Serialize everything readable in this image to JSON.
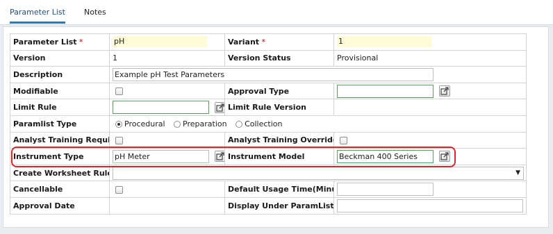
{
  "tabs": [
    {
      "label": "Parameter List",
      "active": true
    },
    {
      "label": "Notes",
      "active": false
    }
  ],
  "form": {
    "parameter_list": {
      "label": "Parameter List",
      "required_mark": "*",
      "value": "pH"
    },
    "variant": {
      "label": "Variant",
      "required_mark": "*",
      "value": "1"
    },
    "version": {
      "label": "Version",
      "value": "1"
    },
    "version_status": {
      "label": "Version Status",
      "value": "Provisional"
    },
    "description": {
      "label": "Description",
      "value": "Example pH Test Parameters"
    },
    "modifiable": {
      "label": "Modifiable",
      "checked": false
    },
    "approval_type": {
      "label": "Approval Type",
      "value": ""
    },
    "limit_rule": {
      "label": "Limit Rule",
      "value": ""
    },
    "limit_rule_version": {
      "label": "Limit Rule Version",
      "value": ""
    },
    "paramlist_type": {
      "label": "Paramlist Type",
      "options": [
        "Procedural",
        "Preparation",
        "Collection"
      ],
      "selected": "Procedural"
    },
    "analyst_training_required": {
      "label": "Analyst Training Required",
      "checked": false
    },
    "analyst_training_overrides": {
      "label": "Analyst Training Overrides",
      "checked": false
    },
    "instrument_type": {
      "label": "Instrument Type",
      "value": "pH Meter"
    },
    "instrument_model": {
      "label": "Instrument Model",
      "value": "Beckman 400 Series"
    },
    "create_worksheet_rule": {
      "label": "Create Worksheet Rule",
      "value": ""
    },
    "cancellable": {
      "label": "Cancellable",
      "checked": false
    },
    "default_usage_time": {
      "label": "Default Usage Time(Minutes)",
      "value": ""
    },
    "approval_date": {
      "label": "Approval Date",
      "value": ""
    },
    "display_under_paramlist": {
      "label": "Display Under ParamList",
      "value": ""
    }
  },
  "colors": {
    "highlight_ring": "#d9262e",
    "required_mark": "#d00000",
    "active_tab_underline": "#2d77b8",
    "readonly_field_bg": "#fdfbd5",
    "lookup_field_border": "#5a9d5a"
  },
  "icons": {
    "lookup": "external-link-icon",
    "dropdown": "caret-down-icon"
  }
}
